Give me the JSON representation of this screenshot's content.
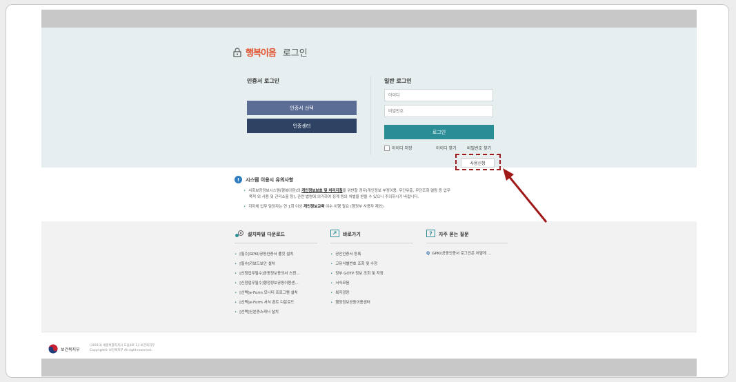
{
  "header": {
    "logo_text": "행복이음",
    "title": "로그인"
  },
  "cert_login": {
    "title": "인증서 로그인",
    "select_button": "인증서 선택",
    "center_button": "인증센터"
  },
  "general_login": {
    "title": "일반 로그인",
    "id_placeholder": "아이디",
    "pw_placeholder": "비밀번호",
    "login_button": "로그인",
    "save_id_label": "아이디 저장",
    "find_id": "아이디 찾기",
    "find_pw": "비밀번호 찾기",
    "apply_button": "사용신청"
  },
  "notice": {
    "title": "시스템 이용시 유의사항",
    "line1_pre": "사회보장정보시스템(행복이음)의 ",
    "line1_bold": "개인정보보호 및 처리지침",
    "line1_post": "을 위반할 경우(개인정보 부정이용, 무단유출, 무단조회·열람 등 업무",
    "line2": "목적 외 사용 및 관리소홀 등), 관련 법령에 의거하여 징계 등의 처벌을 받을 수 있으니 주의하시기 바랍니다.",
    "line3_pre": "지자체 업무 담당자는 연 1회 이상 ",
    "line3_bold": "개인정보교육",
    "line3_post": " 이수 이행 필요 (행정부 사용자 제외)"
  },
  "downloads": {
    "title": "설치파일 다운로드",
    "items": [
      "[필수]GPKI/공동인증서 폴킷 설치",
      "[필수]키보드보안 설치",
      "[신청업무필수]공동정보동의서 스캔...",
      "[신청업무필수]행정정보공동이용센...",
      "[선택]e-Form 모니터 프로그램 설치",
      "[선택]e-Form 서식 폰트 다운로드",
      "[선택]신분증스캐너 설치"
    ]
  },
  "shortcuts": {
    "title": "바로가기",
    "items": [
      "공인인증서 등록",
      "고유식별번호 조회 및 수정",
      "정부 GOTP 정보 조회 및 저장",
      "서식모음",
      "복지광장",
      "행정정보공동이용센터"
    ]
  },
  "faq": {
    "title": "자주 묻는 질문",
    "items": [
      "GPKI/공동인증서 로그인은 어떻게 ..."
    ]
  },
  "footer": {
    "ministry": "보건복지부",
    "address": "(30113) 세종특별자치시 도움4로 13 보건복지부",
    "copyright": "Copyright© 보건복지부 All right reserved."
  },
  "colors": {
    "cert_select": "#5b6c95",
    "cert_center": "#2e4364",
    "login": "#2b8d96",
    "highlight": "#9a1b1b"
  }
}
